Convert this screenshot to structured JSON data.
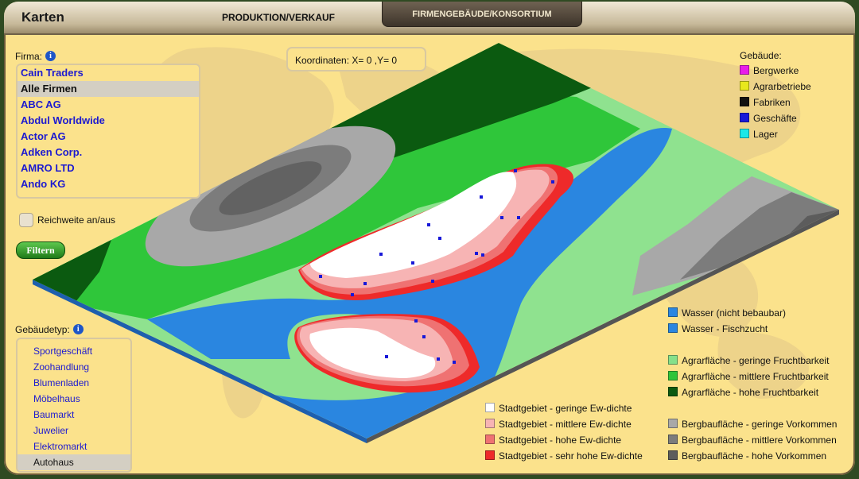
{
  "header": {
    "title": "Karten",
    "tabs": [
      "PRODUKTION/VERKAUF",
      "FIRMENGEBÄUDE/KONSORTIUM"
    ]
  },
  "firma": {
    "label": "Firma:",
    "items": [
      "Cain Traders",
      "Alle Firmen",
      "ABC AG",
      "Abdul Worldwide",
      "Actor AG",
      "Adken Corp.",
      "AMRO LTD",
      "Ando KG"
    ],
    "selected": "Alle Firmen"
  },
  "range_toggle": {
    "label": "Reichweite an/aus",
    "checked": false
  },
  "filter_button": "Filtern",
  "coords": {
    "text": "Koordinaten: X= 0 ,Y= 0"
  },
  "gebaeudetyp": {
    "label": "Gebäudetyp:",
    "items": [
      "Sportgeschäft",
      "Zoohandlung",
      "Blumenladen",
      "Möbelhaus",
      "Baumarkt",
      "Juwelier",
      "Elektromarkt",
      "Autohaus"
    ],
    "selected": "Autohaus"
  },
  "legend_buildings": {
    "title": "Gebäude:",
    "items": [
      {
        "label": "Bergwerke",
        "color": "#e81ce8"
      },
      {
        "label": "Agrarbetriebe",
        "color": "#e8e81c"
      },
      {
        "label": "Fabriken",
        "color": "#111111"
      },
      {
        "label": "Geschäfte",
        "color": "#1818d8"
      },
      {
        "label": "Lager",
        "color": "#1ce8e8"
      }
    ]
  },
  "legend_water": [
    {
      "label": "Wasser (nicht bebaubar)",
      "color": "#2a86e0"
    },
    {
      "label": "Wasser - Fischzucht",
      "color": "#2a86e0"
    }
  ],
  "legend_agrar": [
    {
      "label": "Agrarfläche - geringe Fruchtbarkeit",
      "color": "#86e08a"
    },
    {
      "label": "Agrarfläche - mittlere Fruchtbarkeit",
      "color": "#2ec43a"
    },
    {
      "label": "Agrarfläche - hohe Fruchtbarkeit",
      "color": "#0b5a10"
    }
  ],
  "legend_stadt": [
    {
      "label": "Stadtgebiet - geringe Ew-dichte",
      "color": "#ffffff"
    },
    {
      "label": "Stadtgebiet - mittlere Ew-dichte",
      "color": "#f7b4b4"
    },
    {
      "label": "Stadtgebiet - hohe Ew-dichte",
      "color": "#ef7272"
    },
    {
      "label": "Stadtgebiet - sehr hohe Ew-dichte",
      "color": "#ee2a2a"
    }
  ],
  "legend_berg": [
    {
      "label": "Bergbaufläche - geringe Vorkommen",
      "color": "#a8a8a8"
    },
    {
      "label": "Bergbaufläche - mittlere Vorkommen",
      "color": "#7c7c7c"
    },
    {
      "label": "Bergbaufläche - hohe Vorkommen",
      "color": "#5c5c5c"
    }
  ]
}
